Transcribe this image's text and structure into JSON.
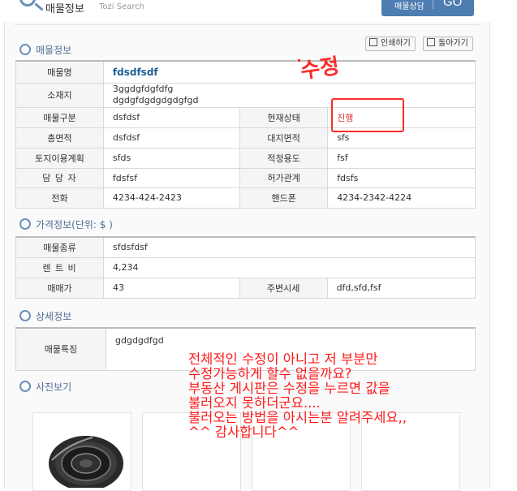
{
  "header": {
    "title": "매물정보",
    "subtitle": "Tozi Search",
    "consult_label": "매물상담",
    "go_label": "GO"
  },
  "toolbar": {
    "print_label": "인쇄하기",
    "back_label": "돌아가기"
  },
  "sections": {
    "property_info": "매물정보",
    "price_info": "가격정보(단위: $ )",
    "detail_info": "상세정보",
    "photos": "사진보기"
  },
  "property": {
    "name_label": "매물명",
    "name": "fdsdfsdf",
    "location_label": "소재지",
    "location_line1": "3ggdgfdgfdfg",
    "location_line2": "dgdgfdgdgdgdgfgd",
    "type_label": "매물구분",
    "type": "dsfdsf",
    "status_label": "현재상태",
    "status": "진행",
    "total_area_label": "총면적",
    "total_area": "dsfdsf",
    "land_area_label": "대지면적",
    "land_area": "sfs",
    "land_plan_label": "토지이용계획",
    "land_plan": "sfds",
    "usage_label": "적정용도",
    "usage": "fsf",
    "manager_label": "담 당 자",
    "manager": "fdsfsf",
    "permit_label": "허가관계",
    "permit": "fdsfs",
    "phone_label": "전화",
    "phone": "4234-424-2423",
    "mobile_label": "핸드폰",
    "mobile": "4234-2342-4224"
  },
  "price": {
    "kind_label": "매물종류",
    "kind": "sfdsfdsf",
    "rent_label": "렌 트 비",
    "rent": "4,234",
    "sale_label": "매매가",
    "sale": "43",
    "market_label": "주변시세",
    "market": "dfd,sfd,fsf"
  },
  "detail": {
    "feature_label": "매물특징",
    "feature": "gdgdgdfgd"
  },
  "annotations": {
    "edit_mark": "수정",
    "note": "전체적인 수정이 아니고 저 부분만\n수정가능하게 할수 없을까요?\n부동산 게시판은 수정을 누르면 값을\n불러오지 못하더군요....\n불러오는 방법을 아시는분 알려주세요,,\n^^ 감사합니다^^"
  },
  "colors": {
    "accent": "#4f6d96",
    "button_blue": "#4d7db1",
    "annotation_red": "#ff1a1a",
    "name_blue": "#1e5f94"
  }
}
